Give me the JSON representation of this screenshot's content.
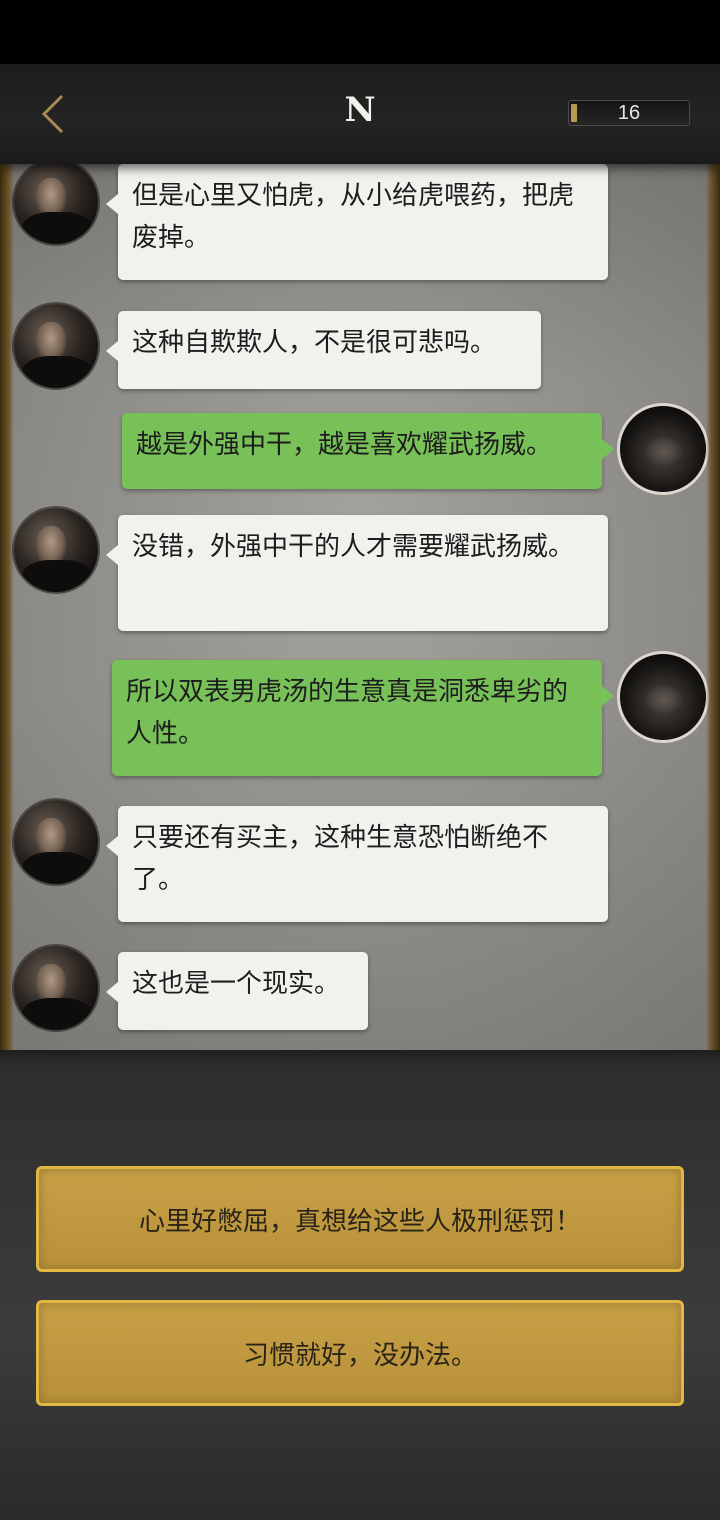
{
  "header": {
    "back_icon": "chevron-left-icon",
    "title": "N",
    "counter_value": "16"
  },
  "messages": [
    {
      "sender": "npc",
      "text": "但是心里又怕虎，从小给虎喂药，把虎废掉。"
    },
    {
      "sender": "npc",
      "text": "这种自欺欺人，不是很可悲吗。"
    },
    {
      "sender": "self",
      "text": "越是外强中干，越是喜欢耀武扬威。"
    },
    {
      "sender": "npc",
      "text": "没错，外强中干的人才需要耀武扬威。"
    },
    {
      "sender": "self",
      "text": "所以双表男虎汤的生意真是洞悉卑劣的人性。"
    },
    {
      "sender": "npc",
      "text": "只要还有买主，这种生意恐怕断绝不了。"
    },
    {
      "sender": "npc",
      "text": "这也是一个现实。"
    }
  ],
  "choices": [
    {
      "label": "心里好憋屈，真想给这些人极刑惩罚！"
    },
    {
      "label": "习惯就好，没办法。"
    }
  ],
  "colors": {
    "npc_bubble": "#f2f1ee",
    "self_bubble": "#78c158",
    "choice_bg": "#b8913a",
    "choice_border": "#e2b842",
    "gold_accent": "#a58a55"
  }
}
